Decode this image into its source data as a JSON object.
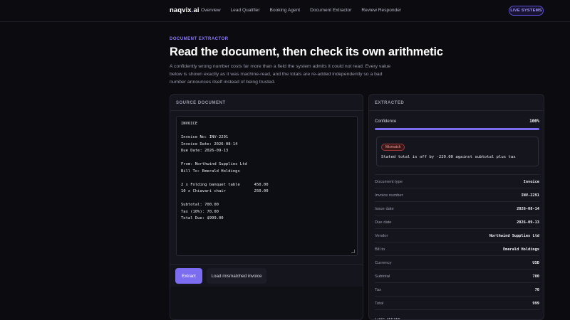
{
  "nav": {
    "brand_name": "naqvix",
    "brand_dot": ".",
    "brand_tld": "ai",
    "links": [
      "Overview",
      "Lead Qualifier",
      "Booking Agent",
      "Document Extractor",
      "Review Responder"
    ],
    "status_badge": "LIVE SYSTEMS"
  },
  "hero": {
    "eyebrow": "DOCUMENT EXTRACTOR",
    "title": "Read the document, then check its own arithmetic",
    "intro": "A confidently wrong number costs far more than a field the system admits it could not read. Every value below is shown exactly as it was machine-read, and the totals are re-added independently so a bad number announces itself instead of being trusted."
  },
  "source": {
    "heading": "SOURCE DOCUMENT",
    "document_text": "INVOICE\n\nInvoice No: INV-2291\nInvoice Date: 2026-08-14\nDue Date: 2026-09-13\n\nFrom: Northwind Supplies Ltd\nBill To: Emerald Holdings\n\n2 x Folding banquet table      450.00\n10 x Chiavari chair            250.00\n\nSubtotal: 700.00\nTax (10%): 70.00\nTotal Due: $999.00",
    "extract_button": "Extract",
    "load_button": "Load mismatched invoice"
  },
  "extracted": {
    "heading": "EXTRACTED",
    "confidence_label": "Confidence",
    "confidence_value": "100%",
    "confidence_fraction": 1.0,
    "alert_badge": "Mismatch",
    "alert_text": "Stated total is off by -229.00 against subtotal plus tax",
    "fields": [
      {
        "label": "Document type",
        "value": "Invoice"
      },
      {
        "label": "Invoice number",
        "value": "INV-2291"
      },
      {
        "label": "Issue date",
        "value": "2026-08-14"
      },
      {
        "label": "Due date",
        "value": "2026-09-13"
      },
      {
        "label": "Vendor",
        "value": "Northwind Supplies Ltd"
      },
      {
        "label": "Bill to",
        "value": "Emerald Holdings"
      },
      {
        "label": "Currency",
        "value": "USD"
      },
      {
        "label": "Subtotal",
        "value": "700"
      },
      {
        "label": "Tax",
        "value": "70"
      },
      {
        "label": "Total",
        "value": "999"
      }
    ],
    "line_items_heading": "LINE ITEMS"
  },
  "colors": {
    "accent": "#7c6cf0",
    "background": "#0b0b10",
    "panel": "#15151e",
    "mismatch": "#f29b9b"
  }
}
